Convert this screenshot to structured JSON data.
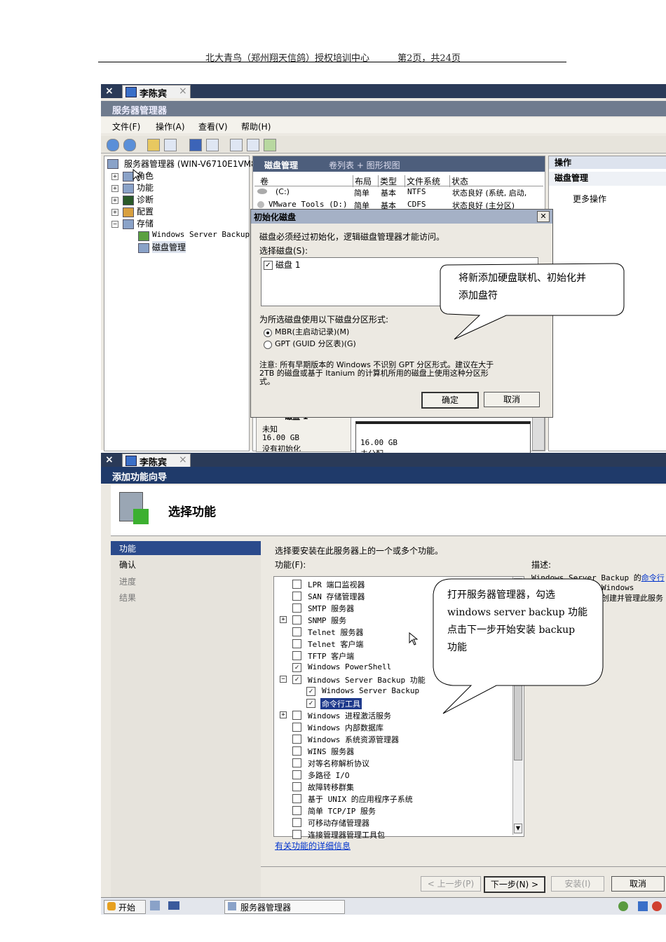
{
  "header": {
    "center_name": "北大青鸟（郑州翔天信鸽）授权培训中心",
    "page_info": "第2页，共24页"
  },
  "session_tab": {
    "name": "李陈宾",
    "close": "×",
    "x": "×"
  },
  "server_manager": {
    "title": "服务器管理器",
    "menu": [
      "文件(F)",
      "操作(A)",
      "查看(V)",
      "帮助(H)"
    ],
    "tree": {
      "root": "服务器管理器 (WIN-V6710E1VM8",
      "items": [
        "角色",
        "功能",
        "诊断",
        "配置",
        "存储"
      ],
      "children": [
        "Windows Server Backup",
        "磁盘管理"
      ]
    },
    "center": {
      "title": "磁盘管理",
      "subtitle": "卷列表 + 图形视图",
      "columns": [
        "卷",
        "布局",
        "类型",
        "文件系统",
        "状态"
      ],
      "rows": [
        [
          "(C:)",
          "简单",
          "基本",
          "NTFS",
          "状态良好 (系统, 启动,"
        ],
        [
          "VMware Tools (D:)",
          "简单",
          "基本",
          "CDFS",
          "状态良好 (主分区)"
        ]
      ],
      "disk_label": "磁盘 1",
      "disk_state": "未知",
      "disk_size": "16.00 GB",
      "disk_init": "没有初始化",
      "unalloc_size": "16.00 GB",
      "unalloc_label": "未分配"
    },
    "actions": {
      "title": "操作",
      "section": "磁盘管理",
      "more": "更多操作"
    }
  },
  "init_dialog": {
    "title": "初始化磁盘",
    "close": "✕",
    "intro": "磁盘必须经过初始化，逻辑磁盘管理器才能访问。",
    "select_label": "选择磁盘(S):",
    "disk_item": "磁盘 1",
    "partition_label": "为所选磁盘使用以下磁盘分区形式:",
    "mbr": "MBR(主启动记录)(M)",
    "gpt": "GPT (GUID 分区表)(G)",
    "note_line1": "注意: 所有早期版本的 Windows 不识别 GPT 分区形式。建议在大于",
    "note_line2": "2TB 的磁盘或基于 Itanium 的计算机所用的磁盘上使用这种分区形",
    "note_line3": "式。",
    "ok": "确定",
    "cancel": "取消"
  },
  "callout1": {
    "line1": "将新添加硬盘联机、初始化并",
    "line2": "添加盘符"
  },
  "wizard": {
    "title": "添加功能向导",
    "heading": "选择功能",
    "nav": [
      "功能",
      "确认",
      "进度",
      "结果"
    ],
    "instruction": "选择要安装在此服务器上的一个或多个功能。",
    "features_label": "功能(F):",
    "desc_label": "描述:",
    "desc_frag1": "Windows Server Backup 的",
    "desc_link": "命令行",
    "desc_frag2": "Windows",
    "desc_frag3": "创建并管理此服务",
    "features": [
      {
        "label": "LPR 端口监视器",
        "checked": false,
        "expand": false,
        "indent": 0
      },
      {
        "label": "SAN 存储管理器",
        "checked": false,
        "expand": false,
        "indent": 0
      },
      {
        "label": "SMTP 服务器",
        "checked": false,
        "expand": false,
        "indent": 0
      },
      {
        "label": "SNMP 服务",
        "checked": false,
        "expand": true,
        "indent": 0
      },
      {
        "label": "Telnet 服务器",
        "checked": false,
        "expand": false,
        "indent": 0
      },
      {
        "label": "Telnet 客户端",
        "checked": false,
        "expand": false,
        "indent": 0
      },
      {
        "label": "TFTP 客户端",
        "checked": false,
        "expand": false,
        "indent": 0
      },
      {
        "label": "Windows PowerShell",
        "checked": true,
        "expand": false,
        "indent": 0
      },
      {
        "label": "Windows Server Backup 功能",
        "checked": true,
        "expand": true,
        "indent": 0
      },
      {
        "label": "Windows Server Backup",
        "checked": true,
        "expand": false,
        "indent": 1
      },
      {
        "label": "命令行工具",
        "checked": true,
        "expand": false,
        "indent": 1,
        "selected": true
      },
      {
        "label": "Windows 进程激活服务",
        "checked": false,
        "expand": true,
        "indent": 0
      },
      {
        "label": "Windows 内部数据库",
        "checked": false,
        "expand": false,
        "indent": 0
      },
      {
        "label": "Windows 系统资源管理器",
        "checked": false,
        "expand": false,
        "indent": 0
      },
      {
        "label": "WINS 服务器",
        "checked": false,
        "expand": false,
        "indent": 0
      },
      {
        "label": "对等名称解析协议",
        "checked": false,
        "expand": false,
        "indent": 0
      },
      {
        "label": "多路径 I/O",
        "checked": false,
        "expand": false,
        "indent": 0
      },
      {
        "label": "故障转移群集",
        "checked": false,
        "expand": false,
        "indent": 0
      },
      {
        "label": "基于 UNIX 的应用程序子系统",
        "checked": false,
        "expand": false,
        "indent": 0
      },
      {
        "label": "简单 TCP/IP 服务",
        "checked": false,
        "expand": false,
        "indent": 0
      },
      {
        "label": "可移动存储管理器",
        "checked": false,
        "expand": false,
        "indent": 0
      },
      {
        "label": "连接管理器管理工具包",
        "checked": false,
        "expand": false,
        "indent": 0
      }
    ],
    "more_info_link": "有关功能的详细信息",
    "buttons": {
      "prev": "< 上一步(P)",
      "next": "下一步(N) >",
      "install": "安装(I)",
      "cancel": "取消"
    }
  },
  "callout2": {
    "line1": "打开服务器管理器，勾选",
    "line2": "windows server backup 功能",
    "line3": "点击下一步开始安装 backup",
    "line4": "功能"
  },
  "taskbar": {
    "start": "开始",
    "app": "服务器管理器"
  }
}
